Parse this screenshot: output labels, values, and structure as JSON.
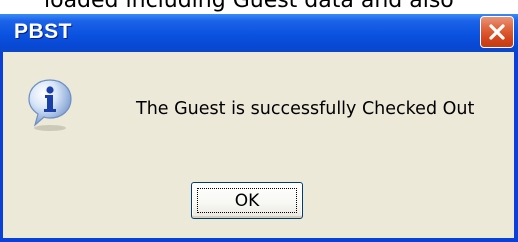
{
  "background": {
    "partial_text": "loaded including Guest data and also"
  },
  "dialog": {
    "title": "PBST",
    "message": "The Guest is successfully Checked Out",
    "ok_label": "OK",
    "icon": "information-icon",
    "close_icon": "close-icon"
  },
  "colors": {
    "title_bar": "#0a52e0",
    "close_button": "#d4471e",
    "client_area": "#ece9d8"
  }
}
